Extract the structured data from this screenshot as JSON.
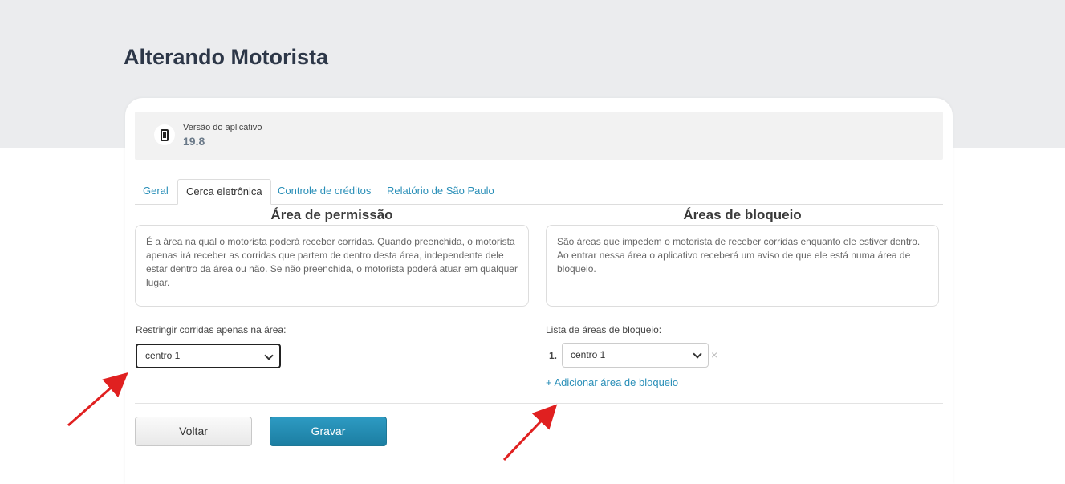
{
  "page": {
    "title": "Alterando Motorista"
  },
  "app_version": {
    "label": "Versão do aplicativo",
    "value": "19.8",
    "icon": "phone-icon"
  },
  "tabs": [
    {
      "label": "Geral",
      "active": false
    },
    {
      "label": "Cerca eletrônica",
      "active": true
    },
    {
      "label": "Controle de créditos",
      "active": false
    },
    {
      "label": "Relatório de São Paulo",
      "active": false
    }
  ],
  "permission": {
    "title": "Área de permissão",
    "description": "É a área na qual o motorista poderá receber corridas. Quando preenchida, o motorista apenas irá receber as corridas que partem de dentro desta área, independente dele estar dentro da área ou não. Se não preenchida, o motorista poderá atuar em qualquer lugar.",
    "field_label": "Restringir corridas apenas na área:",
    "selected": "centro 1"
  },
  "blocking": {
    "title": "Áreas de bloqueio",
    "description_1": "São áreas que impedem o motorista de receber corridas enquanto ele estiver dentro.",
    "description_2": "Ao entrar nessa área o aplicativo receberá um aviso de que ele está numa área de bloqueio.",
    "field_label": "Lista de áreas de bloqueio:",
    "items": [
      {
        "number": "1.",
        "value": "centro 1"
      }
    ],
    "remove_symbol": "×",
    "add_link": "+ Adicionar área de bloqueio"
  },
  "actions": {
    "back": "Voltar",
    "save": "Gravar"
  },
  "colors": {
    "accent": "#2a8fb8",
    "save_button": "#2290b8",
    "annotation_arrow": "#e02020"
  }
}
